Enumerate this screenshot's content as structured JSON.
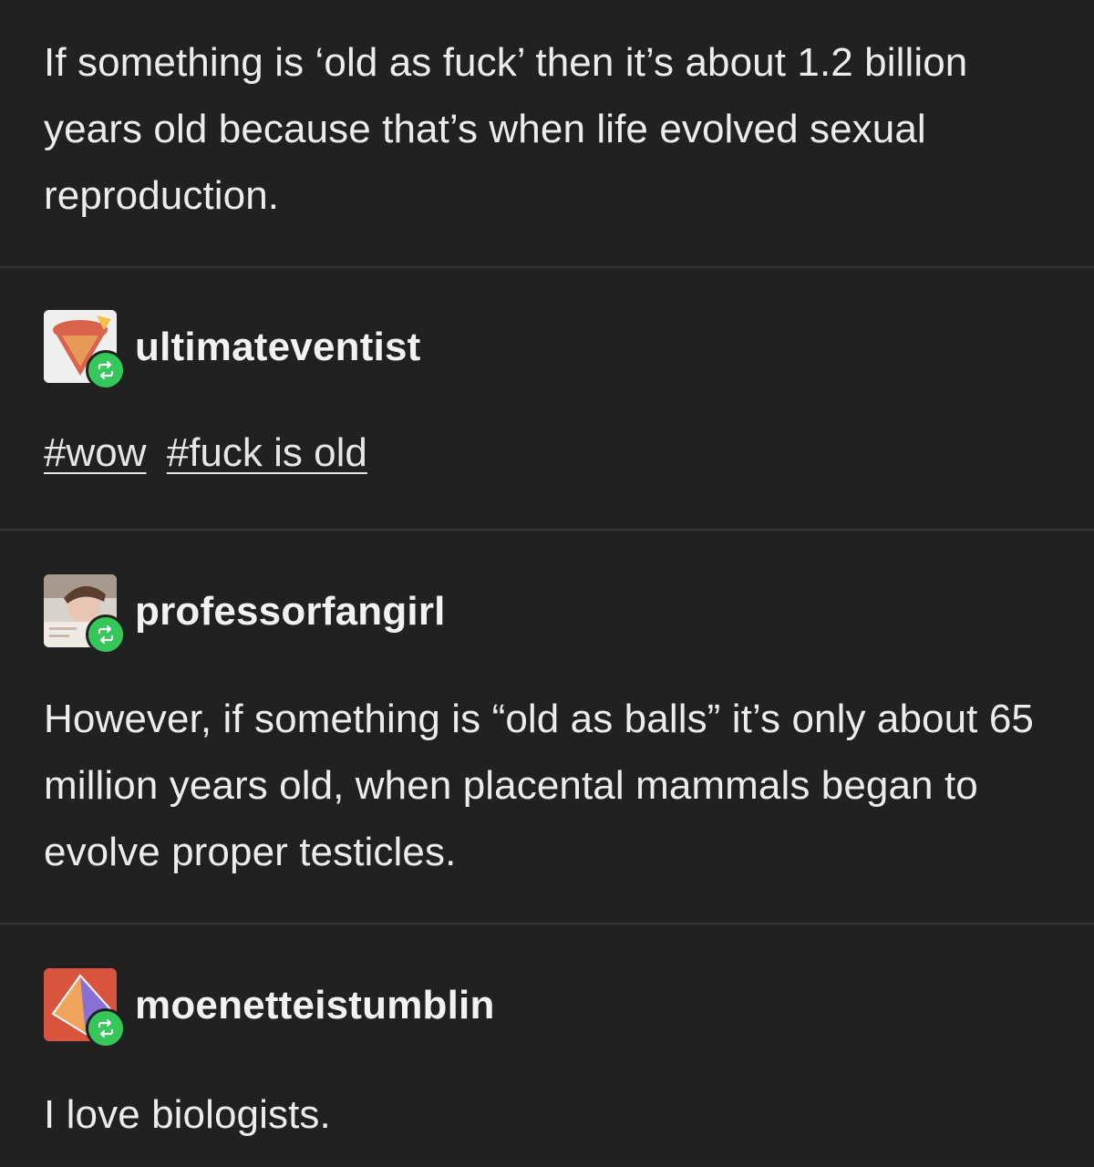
{
  "original_post": {
    "text": "If something is ‘old as fuck’ then it’s about 1.2 billion years old because that’s when life evolved sexual reproduction."
  },
  "reblogs": [
    {
      "username": "ultimateventist",
      "avatar_icon": "ice-cream-cone-avatar-icon",
      "badge_icon": "reblog-icon",
      "tags": [
        "#wow",
        "#fuck is old"
      ]
    },
    {
      "username": "professorfangirl",
      "avatar_icon": "person-photo-avatar-icon",
      "badge_icon": "reblog-icon",
      "text": "However, if something is “old as balls” it’s only about 65 million years old, when placental mammals began to evolve proper testicles."
    },
    {
      "username": "moenetteistumblin",
      "avatar_icon": "geometric-shape-avatar-icon",
      "badge_icon": "reblog-icon",
      "text": "I love biologists."
    }
  ],
  "colors": {
    "background": "#212121",
    "divider": "#333333",
    "text": "#ececec",
    "reblog_badge": "#34c759"
  }
}
